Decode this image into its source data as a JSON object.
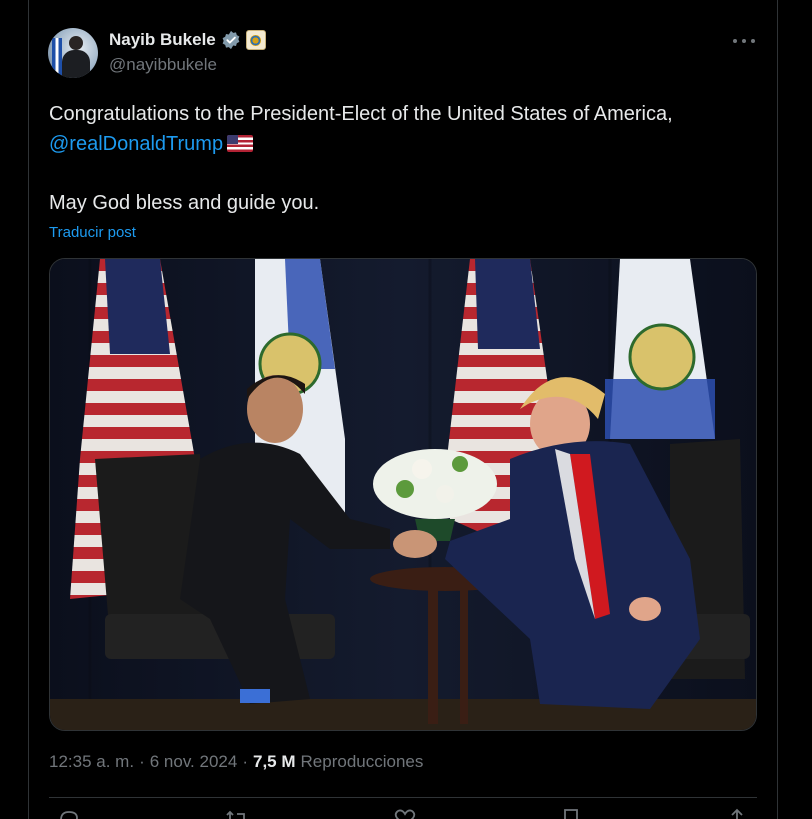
{
  "author": {
    "name": "Nayib Bukele",
    "handle": "@nayibbukele",
    "verified_icon": "verified-badge-icon",
    "affiliate_icon": "government-seal-icon"
  },
  "tweet": {
    "text_line1": "Congratulations to the President-Elect of the United States of America,",
    "mention": "@realDonaldTrump",
    "flag_emoji": "us-flag-emoji",
    "text_line2": "May God bless and guide you.",
    "translate_label": "Traducir post"
  },
  "meta": {
    "time": "12:35 a. m.",
    "separator1": "·",
    "date": "6 nov. 2024",
    "separator2": "·",
    "views_count": "7,5 M",
    "views_label": "Reproducciones"
  },
  "actions": [
    "reply-icon",
    "retweet-icon",
    "like-icon",
    "bookmark-icon",
    "share-icon"
  ],
  "colors": {
    "background": "#000000",
    "text": "#e7e9ea",
    "muted": "#71767b",
    "accent": "#1d9bf0",
    "border": "#2f3336"
  }
}
